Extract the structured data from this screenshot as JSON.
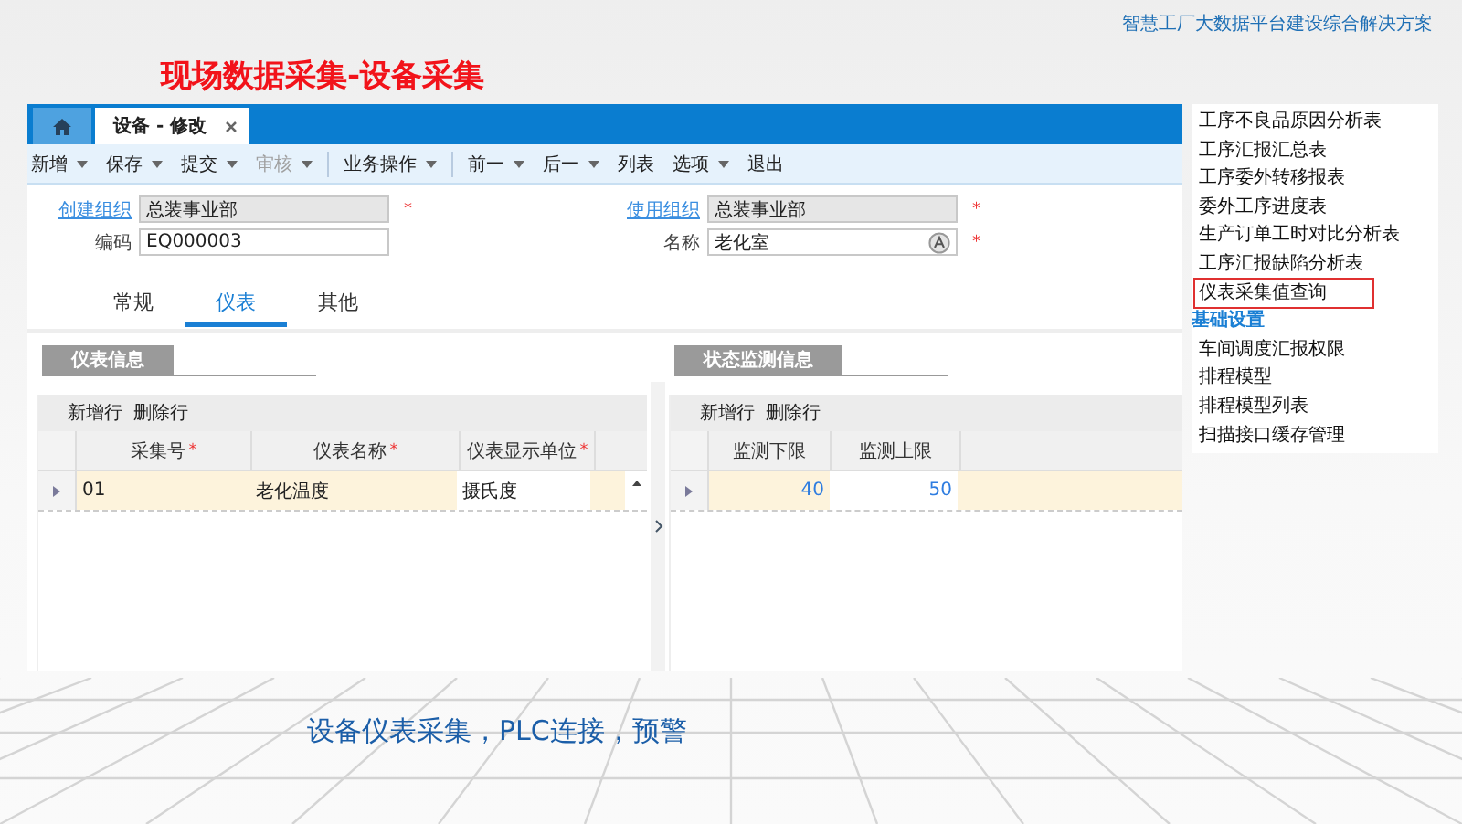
{
  "header": {
    "subtitle": "智慧工厂大数据平台建设综合解决方案",
    "title": "现场数据采集-设备采集"
  },
  "app": {
    "tabs": [
      {
        "label": "设备 - 修改",
        "selected": true,
        "closable": true
      }
    ],
    "toolbar": [
      {
        "label": "新增",
        "dropdown": true,
        "disabled": false,
        "group_end": false
      },
      {
        "label": "保存",
        "dropdown": true,
        "disabled": false,
        "group_end": false
      },
      {
        "label": "提交",
        "dropdown": true,
        "disabled": false,
        "group_end": false
      },
      {
        "label": "审核",
        "dropdown": true,
        "disabled": true,
        "group_end": true
      },
      {
        "label": "业务操作",
        "dropdown": true,
        "disabled": false,
        "group_end": true
      },
      {
        "label": "前一",
        "dropdown": true,
        "disabled": false,
        "group_end": false
      },
      {
        "label": "后一",
        "dropdown": true,
        "disabled": false,
        "group_end": false
      },
      {
        "label": "列表",
        "dropdown": false,
        "disabled": false,
        "group_end": false
      },
      {
        "label": "选项",
        "dropdown": true,
        "disabled": false,
        "group_end": false
      },
      {
        "label": "退出",
        "dropdown": false,
        "disabled": false,
        "group_end": false
      }
    ],
    "fields": [
      {
        "label": "创建组织",
        "value": "总装事业部",
        "link": true,
        "readonly": true,
        "required_mark": "*",
        "lookup": false
      },
      {
        "label": "使用组织",
        "value": "总装事业部",
        "link": true,
        "readonly": true,
        "required_mark": "*",
        "lookup": false
      },
      {
        "label": "编码",
        "value": "EQ000003",
        "link": false,
        "readonly": false,
        "lookup": false
      },
      {
        "label": "名称",
        "value": "老化室",
        "link": false,
        "readonly": false,
        "required_mark": "*",
        "lookup": true
      }
    ],
    "form_tabs": [
      {
        "label": "常规",
        "selected": false
      },
      {
        "label": "仪表",
        "selected": true
      },
      {
        "label": "其他",
        "selected": false
      }
    ],
    "panels": [
      {
        "title": "仪表信息",
        "actions": [
          "新增行",
          "删除行"
        ],
        "scrollbar": true,
        "columns": [
          {
            "label": "采集号",
            "required_mark": "*"
          },
          {
            "label": "仪表名称",
            "required_mark": "*"
          },
          {
            "label": "仪表显示单位",
            "required_mark": "*"
          }
        ],
        "rows": [
          {
            "cells": [
              {
                "text": "01",
                "kind": "text",
                "current": false
              },
              {
                "text": "老化温度",
                "kind": "text",
                "current": false
              },
              {
                "text": "摄氏度",
                "kind": "text",
                "current": true
              }
            ]
          }
        ]
      },
      {
        "title": "状态监测信息",
        "actions": [
          "新增行",
          "删除行"
        ],
        "scrollbar": false,
        "columns": [
          {
            "label": "监测下限"
          },
          {
            "label": "监测上限"
          }
        ],
        "rows": [
          {
            "cells": [
              {
                "text": "40",
                "kind": "number",
                "current": false
              },
              {
                "text": "50",
                "kind": "number",
                "current": true
              }
            ]
          }
        ]
      }
    ]
  },
  "side_menu": [
    {
      "label": "工序不良品原因分析表",
      "kind": "item",
      "highlighted": false
    },
    {
      "label": "工序汇报汇总表",
      "kind": "item",
      "highlighted": false
    },
    {
      "label": "工序委外转移报表",
      "kind": "item",
      "highlighted": false
    },
    {
      "label": "委外工序进度表",
      "kind": "item",
      "highlighted": false
    },
    {
      "label": "生产订单工时对比分析表",
      "kind": "item",
      "highlighted": false
    },
    {
      "label": "工序汇报缺陷分析表",
      "kind": "item",
      "highlighted": false
    },
    {
      "label": "仪表采集值查询",
      "kind": "item",
      "highlighted": true
    },
    {
      "label": "基础设置",
      "kind": "heading",
      "highlighted": false
    },
    {
      "label": "车间调度汇报权限",
      "kind": "item",
      "highlighted": false
    },
    {
      "label": "排程模型",
      "kind": "item",
      "highlighted": false
    },
    {
      "label": "排程模型列表",
      "kind": "item",
      "highlighted": false
    },
    {
      "label": "扫描接口缓存管理",
      "kind": "item",
      "highlighted": false
    }
  ],
  "caption": "设备仪表采集，PLC连接，预警"
}
